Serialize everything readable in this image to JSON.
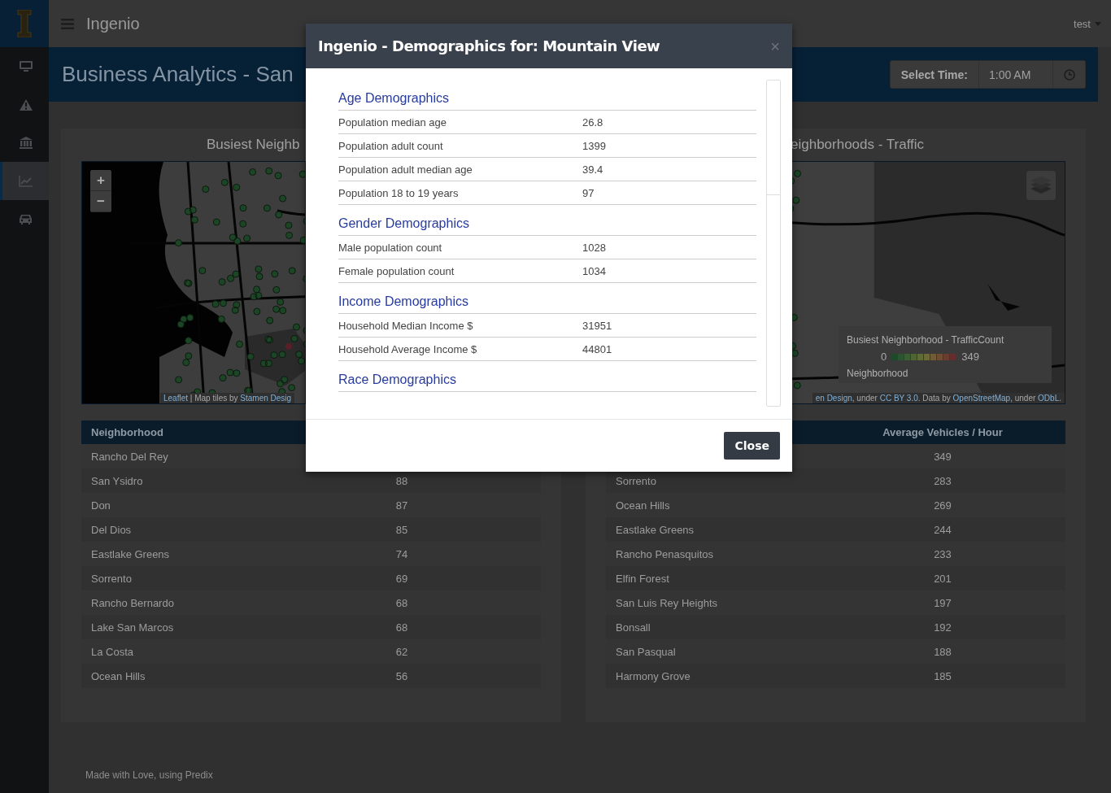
{
  "topbar": {
    "title": "Ingenio",
    "user": "test"
  },
  "sidebar": {
    "items": [
      {
        "kind": "monitor",
        "selected": false
      },
      {
        "kind": "warning",
        "selected": false
      },
      {
        "kind": "bank",
        "selected": false
      },
      {
        "kind": "chart",
        "selected": true
      },
      {
        "kind": "car",
        "selected": false
      }
    ]
  },
  "header": {
    "title": "Business Analytics - San",
    "time_label": "Select Time:",
    "time_value": "1:00 AM"
  },
  "panels": [
    {
      "title": "Busiest Neighb",
      "map": {
        "zoom_in": "+",
        "zoom_out": "−",
        "attribution": [
          {
            "kind": "link",
            "text": "Leaflet"
          },
          {
            "kind": "text",
            "text": " | Map tiles by "
          },
          {
            "kind": "link",
            "text": "Stamen Desig"
          }
        ]
      },
      "table": {
        "heading_name": "Neighborhood",
        "rows": [
          {
            "name": "Rancho Del Rey"
          },
          {
            "name": "San Ysidro",
            "value": "88"
          },
          {
            "name": "Don",
            "value": "87"
          },
          {
            "name": "Del Dios",
            "value": "85"
          },
          {
            "name": "Eastlake Greens",
            "value": "74"
          },
          {
            "name": "Sorrento",
            "value": "69"
          },
          {
            "name": "Rancho Bernardo",
            "value": "68"
          },
          {
            "name": "Lake San Marcos",
            "value": "68"
          },
          {
            "name": "La Costa",
            "value": "62"
          },
          {
            "name": "Ocean Hills",
            "value": "56"
          }
        ]
      }
    },
    {
      "title": "eighborhoods - Traffic",
      "map": {
        "layers_control": true,
        "legend": {
          "title": "Busiest Neighborhood - TrafficCount",
          "min": "0",
          "max": "349",
          "label": "Neighborhood"
        },
        "attribution": [
          {
            "kind": "link",
            "text": "en Design"
          },
          {
            "kind": "text",
            "text": ", under "
          },
          {
            "kind": "link",
            "text": "CC BY 3.0"
          },
          {
            "kind": "text",
            "text": ". Data by "
          },
          {
            "kind": "link",
            "text": "OpenStreetMap"
          },
          {
            "kind": "text",
            "text": ", under "
          },
          {
            "kind": "link",
            "text": "ODbL"
          },
          {
            "kind": "text",
            "text": "."
          }
        ]
      },
      "table": {
        "heading_value": "Average Vehicles / Hour",
        "rows": [
          {
            "value": "349"
          },
          {
            "name": "Sorrento",
            "value": "283"
          },
          {
            "name": "Ocean Hills",
            "value": "269"
          },
          {
            "name": "Eastlake Greens",
            "value": "244"
          },
          {
            "name": "Rancho Penasquitos",
            "value": "233"
          },
          {
            "name": "Elfin Forest",
            "value": "201"
          },
          {
            "name": "San Luis Rey Heights",
            "value": "197"
          },
          {
            "name": "Bonsall",
            "value": "192"
          },
          {
            "name": "San Pasqual",
            "value": "188"
          },
          {
            "name": "Harmony Grove",
            "value": "185"
          }
        ]
      }
    }
  ],
  "footer": "Made with Love, using Predix",
  "modal": {
    "title": "Ingenio - Demographics for: Mountain View",
    "close_glyph": "×",
    "button": "Close",
    "sections": [
      {
        "heading": "Age Demographics",
        "rows": [
          {
            "label": "Population median age",
            "value": "26.8"
          },
          {
            "label": "Population adult count",
            "value": "1399"
          },
          {
            "label": "Population adult median age",
            "value": "39.4"
          },
          {
            "label": "Population 18 to 19 years",
            "value": "97"
          }
        ]
      },
      {
        "heading": "Gender Demographics",
        "rows": [
          {
            "label": "Male population count",
            "value": "1028"
          },
          {
            "label": "Female population count",
            "value": "1034"
          }
        ]
      },
      {
        "heading": "Income Demographics",
        "rows": [
          {
            "label": "Household Median Income $",
            "value": "31951"
          },
          {
            "label": "Household Average Income $",
            "value": "44801"
          }
        ]
      },
      {
        "heading": "Race Demographics"
      }
    ]
  }
}
